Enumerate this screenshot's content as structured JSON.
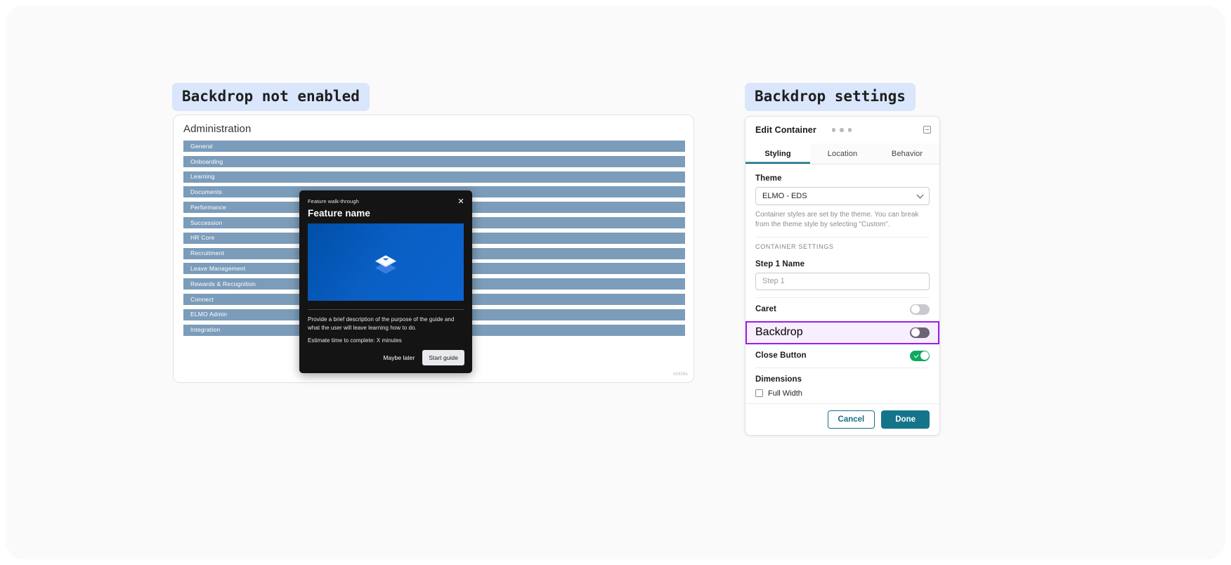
{
  "labels": {
    "left": "Backdrop not enabled",
    "right": "Backdrop settings"
  },
  "admin_card": {
    "title": "Administration",
    "nav_items": [
      "General",
      "Onboarding",
      "Learning",
      "Documents",
      "Performance",
      "Succession",
      "HR Core",
      "Recruitment",
      "Leave Management",
      "Rewards & Recognition",
      "Connect",
      "ELMO Admin",
      "Integration"
    ],
    "watermark": "42939e"
  },
  "walkthrough_modal": {
    "eyebrow": "Feature walk-through",
    "title": "Feature name",
    "close_icon": "close-icon",
    "description": "Provide a brief description of the purpose of the guide and what the user will leave learning how to do.",
    "estimate": "Estimate time to complete: X minutes",
    "secondary_button": "Maybe later",
    "primary_button": "Start guide"
  },
  "settings_panel": {
    "title": "Edit Container",
    "minimize_icon": "minimize-icon",
    "tabs": [
      {
        "label": "Styling",
        "active": true
      },
      {
        "label": "Location",
        "active": false
      },
      {
        "label": "Behavior",
        "active": false
      }
    ],
    "theme": {
      "label": "Theme",
      "value": "ELMO - EDS",
      "chevron_icon": "chevron-down-icon",
      "helper": "Container styles are set by the theme. You can break from the theme style by selecting \"Custom\"."
    },
    "container_settings_caption": "CONTAINER SETTINGS",
    "step_name": {
      "label": "Step 1 Name",
      "value": "",
      "placeholder": "Step 1"
    },
    "toggles": [
      {
        "label": "Caret",
        "state": "off",
        "highlighted": false
      },
      {
        "label": "Backdrop",
        "state": "off",
        "highlighted": true
      },
      {
        "label": "Close Button",
        "state": "on",
        "highlighted": false
      }
    ],
    "dimensions": {
      "label": "Dimensions",
      "checkbox_label": "Full Width",
      "checked": false
    },
    "footer": {
      "cancel": "Cancel",
      "done": "Done"
    }
  },
  "colors": {
    "pill_bg": "#d9e6fb",
    "nav_bar": "#7b9cba",
    "accent_teal": "#14758a",
    "highlight_purple": "#9b1ee8",
    "highlight_fill": "#f7eefe",
    "toggle_on_green": "#0caa60",
    "modal_bg": "#141414",
    "media_blue": "#0a5fc4"
  }
}
